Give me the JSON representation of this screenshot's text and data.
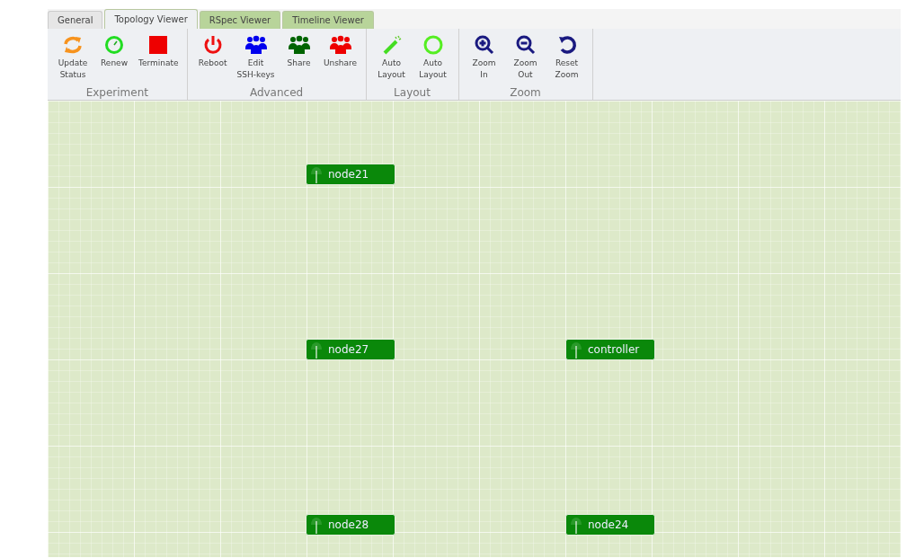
{
  "tabs": [
    {
      "label": "General",
      "selected": false
    },
    {
      "label": "Topology Viewer",
      "selected": true
    },
    {
      "label": "RSpec Viewer",
      "selected": false
    },
    {
      "label": "Timeline Viewer",
      "selected": false
    }
  ],
  "toolbar": [
    {
      "title": "Experiment",
      "buttons": [
        {
          "kind": "refresh",
          "lines": [
            "Update",
            "Status"
          ]
        },
        {
          "kind": "clock",
          "lines": [
            "Renew"
          ]
        },
        {
          "kind": "stop",
          "lines": [
            "Terminate"
          ]
        }
      ]
    },
    {
      "title": "Advanced",
      "buttons": [
        {
          "kind": "power",
          "lines": [
            "Reboot"
          ]
        },
        {
          "kind": "people",
          "color": "#0000ee",
          "lines": [
            "Edit",
            "SSH-keys"
          ]
        },
        {
          "kind": "people",
          "color": "#006400",
          "lines": [
            "Share"
          ]
        },
        {
          "kind": "people",
          "color": "#ee0000",
          "lines": [
            "Unshare"
          ]
        }
      ]
    },
    {
      "title": "Layout",
      "buttons": [
        {
          "kind": "wand",
          "lines": [
            "Auto",
            "Layout"
          ]
        },
        {
          "kind": "ring",
          "lines": [
            "Auto",
            "Layout"
          ]
        }
      ]
    },
    {
      "title": "Zoom",
      "buttons": [
        {
          "kind": "zoom-in",
          "lines": [
            "Zoom",
            "In"
          ]
        },
        {
          "kind": "zoom-out",
          "lines": [
            "Zoom",
            "Out"
          ]
        },
        {
          "kind": "undo",
          "lines": [
            "Reset",
            "Zoom"
          ]
        }
      ]
    }
  ],
  "nodes": [
    {
      "name": "node21"
    },
    {
      "name": "node27"
    },
    {
      "name": "controller"
    },
    {
      "name": "node28"
    },
    {
      "name": "node24"
    }
  ]
}
